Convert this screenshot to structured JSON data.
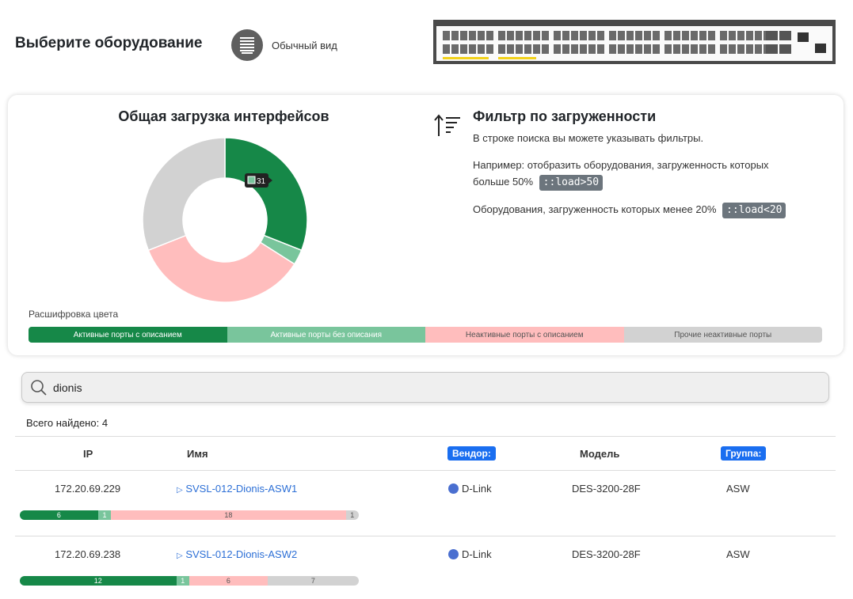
{
  "header": {
    "title": "Выберите оборудование",
    "view_label": "Обычный вид"
  },
  "colors": {
    "active_desc": "#168848",
    "active_nodesc": "#79c59c",
    "inactive_desc": "#ffbdbd",
    "inactive_other": "#d2d2d2"
  },
  "chart": {
    "title": "Общая загрузка интерфейсов",
    "tooltip_value": "31"
  },
  "chart_data": {
    "type": "pie",
    "categories": [
      "Активные порты с описанием",
      "Активные порты без описания",
      "Неактивные порты с описанием",
      "Прочие неактивные порты"
    ],
    "values": [
      31,
      3,
      35,
      31
    ],
    "tooltip": "31"
  },
  "filter": {
    "title": "Фильтр по загруженности",
    "hint": "В строке поиска вы можете указывать фильтры.",
    "example1_text": "Например: отобразить оборудования, загруженность которых больше 50%",
    "example1_code": "::load>50",
    "example2_text": "Оборудования, загруженность которых менее 20%",
    "example2_code": "::load<20"
  },
  "legend": {
    "title": "Расшифровка цвета",
    "items": [
      "Активные порты с описанием",
      "Активные порты без описания",
      "Неактивные порты с описанием",
      "Прочие неактивные порты"
    ]
  },
  "search": {
    "value": "dionis"
  },
  "results": {
    "found_label": "Всего найдено: 4",
    "columns": {
      "ip": "IP",
      "name": "Имя",
      "vendor": "Вендор:",
      "model": "Модель",
      "group": "Группа:"
    },
    "rows": [
      {
        "ip": "172.20.69.229",
        "name": "SVSL-012-Dionis-ASW1",
        "vendor": "D-Link",
        "model": "DES-3200-28F",
        "group": "ASW",
        "load": [
          6,
          1,
          18,
          1
        ]
      },
      {
        "ip": "172.20.69.238",
        "name": "SVSL-012-Dionis-ASW2",
        "vendor": "D-Link",
        "model": "DES-3200-28F",
        "group": "ASW",
        "load": [
          12,
          1,
          6,
          7
        ]
      }
    ]
  }
}
